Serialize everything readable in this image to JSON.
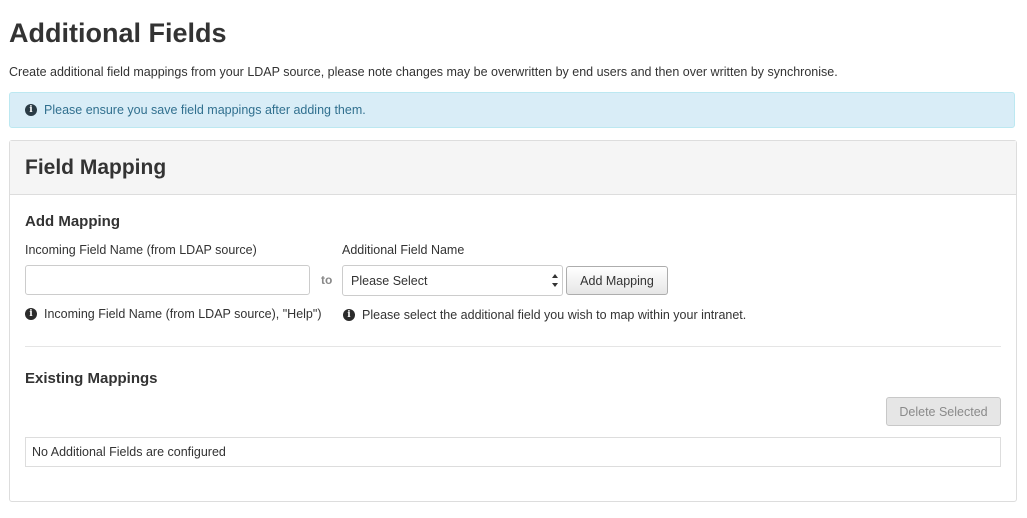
{
  "page": {
    "title": "Additional Fields",
    "description": "Create additional field mappings from your LDAP source, please note changes may be overwritten by end users and then over written by synchronise."
  },
  "alert": {
    "text": "Please ensure you save field mappings after adding them.",
    "icon": "info-icon",
    "background": "#d9edf7",
    "color": "#31708f"
  },
  "panel": {
    "title": "Field Mapping",
    "add_mapping": {
      "heading": "Add Mapping",
      "incoming_label": "Incoming Field Name (from LDAP source)",
      "incoming_value": "",
      "to_label": "to",
      "additional_label": "Additional Field Name",
      "select_value": "Please Select",
      "add_button": "Add Mapping",
      "incoming_help": "Incoming Field Name (from LDAP source), \"Help\")",
      "additional_help": "Please select the additional field you wish to map within your intranet."
    },
    "existing": {
      "heading": "Existing Mappings",
      "delete_button": "Delete Selected",
      "empty_text": "No Additional Fields are configured"
    }
  }
}
